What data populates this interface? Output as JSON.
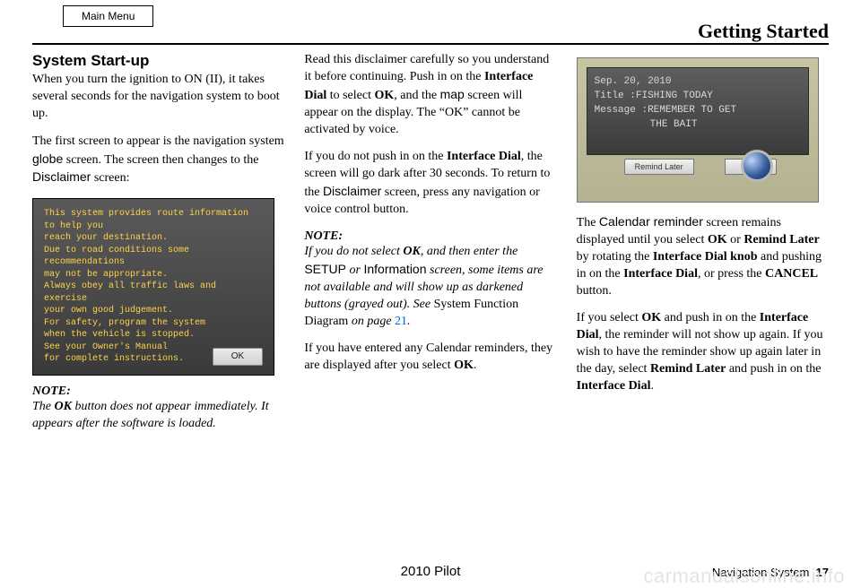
{
  "top_bar": {
    "main_menu": "Main Menu"
  },
  "header": {
    "title": "Getting Started"
  },
  "section": {
    "heading": "System Start-up"
  },
  "col1": {
    "p1_a": "When you turn the ignition to ON (II), it takes several seconds for the navigation system to boot up.",
    "p2_a": "The first screen to appear is the navigation system ",
    "p2_b": "globe",
    "p2_c": " screen. The screen then changes to the ",
    "p2_d": "Disclaimer",
    "p2_e": " screen:",
    "note_title": "NOTE:",
    "note_a": "The ",
    "note_b": "OK",
    "note_c": " button does not appear immediately. It appears after the software is loaded."
  },
  "disclaimer_screen": {
    "l1": "This system provides route information to help you",
    "l2": "reach your destination.",
    "l3": "Due to road conditions some recommendations",
    "l4": "may not be appropriate.",
    "l5": "Always obey all traffic laws and exercise",
    "l6": "your own good judgement.",
    "l7": "For safety, program the system",
    "l8": "when the vehicle is stopped.",
    "l9": "See your Owner's Manual",
    "l10": "for complete instructions.",
    "ok": "OK"
  },
  "col2": {
    "p1_a": "Read this disclaimer carefully so you understand it before continuing. Push in on the ",
    "p1_b": "Interface Dial",
    "p1_c": " to select ",
    "p1_d": "OK",
    "p1_e": ", and the ",
    "p1_f": "map",
    "p1_g": " screen will appear on the display. The “OK” cannot be activated by voice.",
    "p2_a": "If you do not push in on the ",
    "p2_b": "Interface Dial",
    "p2_c": ", the screen will go dark after 30 seconds. To return to the ",
    "p2_d": "Disclaimer",
    "p2_e": " screen, press any navigation or voice control button.",
    "note_title": "NOTE:",
    "note_a": "If you do not select ",
    "note_b": "OK",
    "note_c": ", and then enter the ",
    "note_d": "SETUP",
    "note_e": " or ",
    "note_f": "Information",
    "note_g": " screen, some items are not available and will show up as darkened buttons (grayed out). See ",
    "note_h": "System Function Diagram",
    "note_i": " on page ",
    "note_j": "21",
    "note_k": ".",
    "p3_a": "If you have entered any Calendar reminders, they are displayed after you select ",
    "p3_b": "OK",
    "p3_c": "."
  },
  "calendar_screen": {
    "date": "Sep. 20, 2010",
    "title_label": "Title   :",
    "title_value": "FISHING TODAY",
    "msg_label": "Message :",
    "msg_value1": "REMEMBER TO GET",
    "msg_value2": "THE BAIT",
    "remind_later": "Remind Later",
    "ok": "OK"
  },
  "col3": {
    "p1_a": "The ",
    "p1_b": "Calendar reminder",
    "p1_c": " screen remains displayed until you select ",
    "p1_d": "OK",
    "p1_e": " or ",
    "p1_f": "Remind Later",
    "p1_g": " by rotating the ",
    "p1_h": "Interface Dial knob",
    "p1_i": " and pushing in on the ",
    "p1_j": "Interface Dial",
    "p1_k": ", or press the ",
    "p1_l": "CANCEL",
    "p1_m": " button.",
    "p2_a": "If you select ",
    "p2_b": "OK",
    "p2_c": " and push in on the ",
    "p2_d": "Interface Dial",
    "p2_e": ", the reminder will not show up again. If you wish to have the reminder show up again later in the day, select ",
    "p2_f": "Remind Later",
    "p2_g": " and push in on the ",
    "p2_h": "Interface Dial",
    "p2_i": "."
  },
  "footer": {
    "center": "2010 Pilot",
    "right_label": "Navigation System",
    "right_page": "17"
  },
  "watermark": "carmanualsonline.info"
}
